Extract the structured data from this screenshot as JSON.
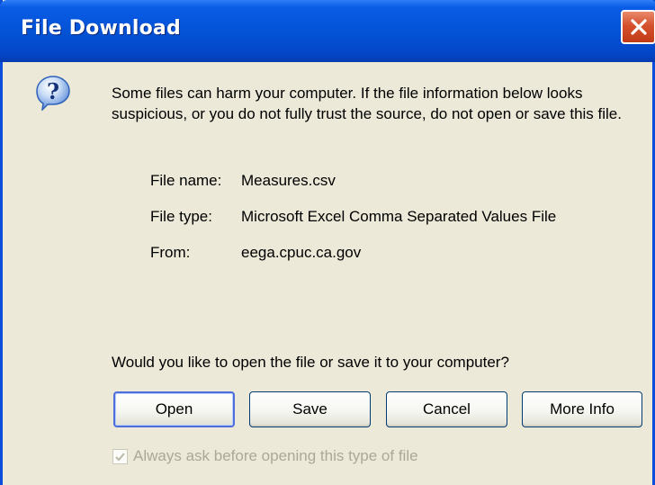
{
  "dialog": {
    "title": "File Download",
    "warning": "Some files can harm your computer. If the file information below looks suspicious, or you do not fully trust the source, do not open or save this file.",
    "file_name_label": "File name:",
    "file_name": "Measures.csv",
    "file_type_label": "File type:",
    "file_type": "Microsoft Excel Comma Separated Values File",
    "from_label": "From:",
    "from": "eega.cpuc.ca.gov",
    "question": "Would you like to open the file or save it to your computer?",
    "buttons": {
      "open": "Open",
      "save": "Save",
      "cancel": "Cancel",
      "more_info": "More Info"
    },
    "checkbox_label": "Always ask before opening this type of file",
    "checkbox_checked": true
  },
  "icons": {
    "question": "question-icon",
    "close": "close-icon",
    "check": "check-icon"
  },
  "colors": {
    "titlebar": "#0453d6",
    "face": "#ece9d8",
    "close": "#d5512e",
    "disabled_text": "#aca899"
  }
}
